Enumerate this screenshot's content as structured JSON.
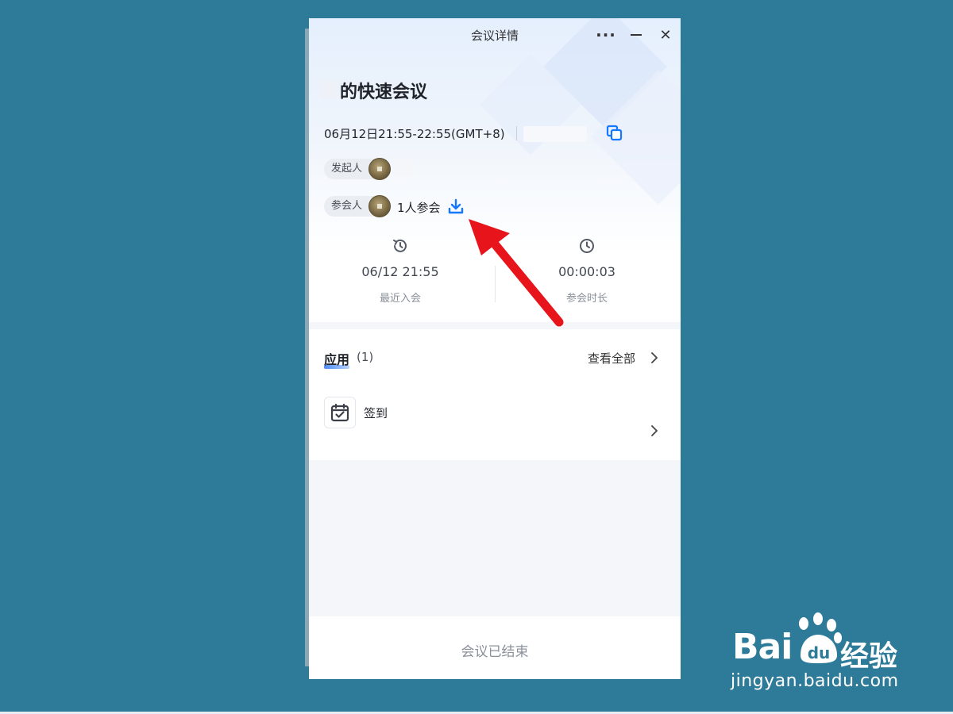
{
  "window": {
    "title": "会议详情",
    "more_icon": "more-horizontal-icon",
    "minimize_icon": "minimize-icon",
    "close_icon": "close-icon"
  },
  "meeting": {
    "title": "的快速会议",
    "time": "06月12日21:55-22:55(GMT+8)",
    "copy_icon": "copy-icon"
  },
  "initiator": {
    "label": "发起人"
  },
  "participants": {
    "label": "参会人",
    "count_text": "1人参会",
    "download_icon": "download-icon"
  },
  "stats": [
    {
      "icon": "history-clock-icon",
      "value": "06/12 21:55",
      "label": "最近入会"
    },
    {
      "icon": "clock-icon",
      "value": "00:00:03",
      "label": "参会时长"
    }
  ],
  "apps": {
    "title": "应用",
    "count": "(1)",
    "view_all": "查看全部",
    "items": [
      {
        "icon": "check-in-calendar-icon",
        "label": "签到"
      }
    ]
  },
  "footer": {
    "status": "会议已结束"
  },
  "watermark": {
    "brand_bai": "Bai",
    "brand_du": "du",
    "brand_jy": "经验",
    "url": "jingyan.baidu.com"
  },
  "colors": {
    "accent": "#1677ff",
    "background": "#2e7b99",
    "arrow": "#e8141b"
  }
}
